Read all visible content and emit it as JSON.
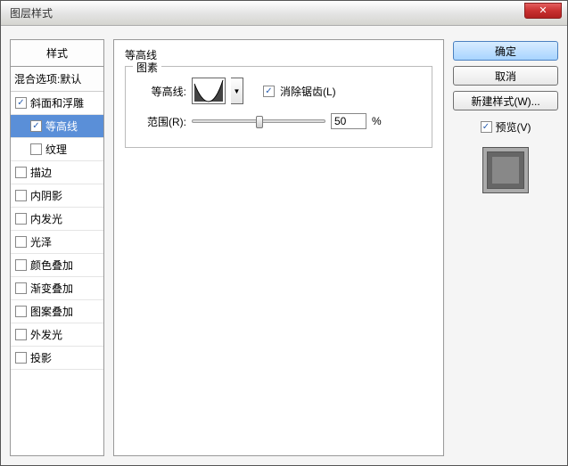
{
  "window": {
    "title": "图层样式",
    "close_glyph": "✕"
  },
  "styles": {
    "header": "样式",
    "blend_options": "混合选项:默认",
    "items": [
      {
        "label": "斜面和浮雕",
        "checked": true,
        "sub": false,
        "selected": false
      },
      {
        "label": "等高线",
        "checked": true,
        "sub": true,
        "selected": true
      },
      {
        "label": "纹理",
        "checked": false,
        "sub": true,
        "selected": false
      },
      {
        "label": "描边",
        "checked": false,
        "sub": false,
        "selected": false
      },
      {
        "label": "内阴影",
        "checked": false,
        "sub": false,
        "selected": false
      },
      {
        "label": "内发光",
        "checked": false,
        "sub": false,
        "selected": false
      },
      {
        "label": "光泽",
        "checked": false,
        "sub": false,
        "selected": false
      },
      {
        "label": "颜色叠加",
        "checked": false,
        "sub": false,
        "selected": false
      },
      {
        "label": "渐变叠加",
        "checked": false,
        "sub": false,
        "selected": false
      },
      {
        "label": "图案叠加",
        "checked": false,
        "sub": false,
        "selected": false
      },
      {
        "label": "外发光",
        "checked": false,
        "sub": false,
        "selected": false
      },
      {
        "label": "投影",
        "checked": false,
        "sub": false,
        "selected": false
      }
    ]
  },
  "settings": {
    "title": "等高线",
    "group": "图素",
    "contour_label": "等高线:",
    "antialias": {
      "label": "消除锯齿(L)",
      "checked": true
    },
    "range": {
      "label": "范围(R):",
      "value": "50",
      "unit": "%",
      "percent": 50
    }
  },
  "actions": {
    "ok": "确定",
    "cancel": "取消",
    "new_style": "新建样式(W)...",
    "preview": {
      "label": "预览(V)",
      "checked": true
    }
  }
}
